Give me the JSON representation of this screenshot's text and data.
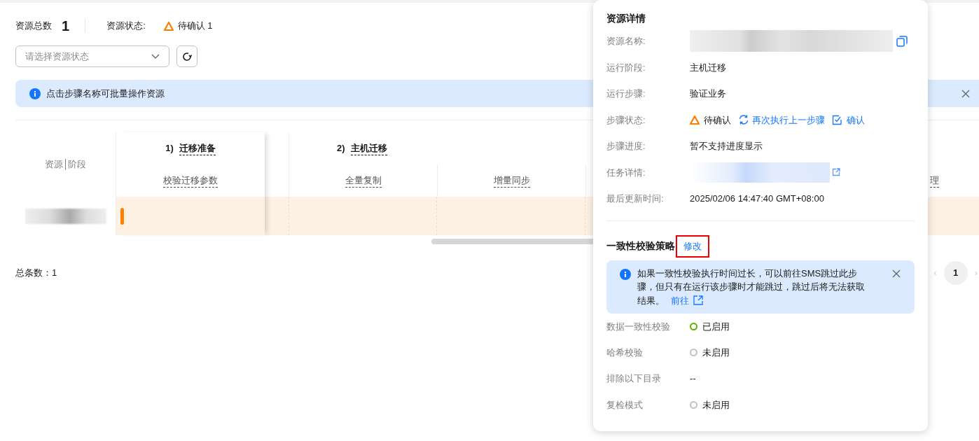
{
  "summary": {
    "total_label": "资源总数",
    "total": "1",
    "status_label": "资源状态:",
    "status": "待确认 1"
  },
  "filter": {
    "placeholder": "请选择资源状态"
  },
  "notice": {
    "text": "点击步骤名称可批量操作资源"
  },
  "table": {
    "corner": [
      "资源",
      "阶段"
    ],
    "stages": [
      {
        "number": "1)",
        "name": "迁移准备",
        "steps": [
          "校验迁移参数"
        ]
      },
      {
        "number": "2)",
        "name": "主机迁移",
        "steps": [
          "全量复制",
          "增量同步"
        ]
      }
    ],
    "partial_step": "理"
  },
  "total": "总条数：1",
  "pagination": {
    "previous": "‹",
    "pages": [
      {
        "label": "1",
        "selected": true
      }
    ],
    "next": "›"
  },
  "popover": {
    "title": "资源详情",
    "fields": [
      {
        "label": "资源名称:",
        "kind": "redacted"
      },
      {
        "label": "运行阶段:",
        "kind": "text",
        "value": "主机迁移"
      },
      {
        "label": "运行步骤:",
        "kind": "text",
        "value": "验证业务"
      },
      {
        "label": "步骤状态:",
        "kind": "status",
        "value": "待确认",
        "actions": [
          "再次执行上一步骤",
          "确认"
        ]
      },
      {
        "label": "步骤进度:",
        "kind": "text",
        "value": "暂不支持进度显示"
      },
      {
        "label": "任务详情:",
        "kind": "redacted_link"
      },
      {
        "label": "最后更新时间:",
        "kind": "text",
        "value": "2025/02/06 14:47:40 GMT+08:00"
      }
    ],
    "policy": {
      "title": "一致性校验策略",
      "edit": "修改",
      "notice": {
        "text": "如果一致性校验执行时间过长，可以前往SMS跳过此步骤，但只有在运行该步骤时才能跳过，跳过后将无法获取结果。",
        "link": "前往"
      },
      "settings": [
        {
          "label": "数据一致性校验",
          "kind": "toggle",
          "enabled": true,
          "value": "已启用"
        },
        {
          "label": "哈希校验",
          "kind": "toggle",
          "enabled": false,
          "value": "未启用"
        },
        {
          "label": "排除以下目录",
          "kind": "text",
          "value": "--"
        },
        {
          "label": "复检模式",
          "kind": "toggle",
          "enabled": false,
          "value": "未启用"
        }
      ]
    }
  }
}
